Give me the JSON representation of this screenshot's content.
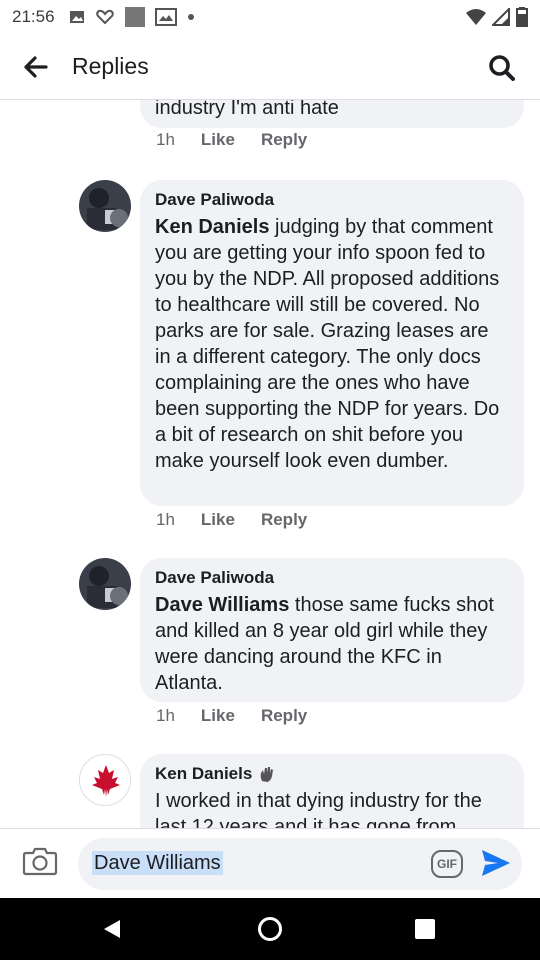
{
  "status_bar": {
    "time": "21:56",
    "icons_left": [
      "image-icon",
      "heart-outline-icon",
      "gray-square-icon",
      "mail-photo-icon",
      "dot-icon"
    ],
    "icons_right": [
      "wifi-icon",
      "signal-icon",
      "battery-icon"
    ]
  },
  "header": {
    "title": "Replies",
    "back_icon": "arrow-left-icon",
    "search_icon": "search-icon"
  },
  "comments": [
    {
      "partial": true,
      "text_tail": "industry I'm anti hate",
      "time": "1h",
      "like_label": "Like",
      "reply_label": "Reply"
    },
    {
      "author": "Dave Paliwoda",
      "mention": "Ken Daniels",
      "text": "judging by that comment you are getting your info spoon fed to you by the NDP. All proposed additions to healthcare will still be covered. No parks are for sale. Grazing leases are in a different category. The only docs complaining are the ones who have been supporting the NDP for years. Do a bit of research on shit before you make yourself look even dumber.",
      "time": "1h",
      "like_label": "Like",
      "reply_label": "Reply"
    },
    {
      "author": "Dave Paliwoda",
      "mention": "Dave Williams",
      "text": "those same fucks shot and killed an 8 year old girl while they were dancing around the KFC in Atlanta.",
      "time": "1h",
      "like_label": "Like",
      "reply_label": "Reply"
    },
    {
      "author": "Ken Daniels",
      "author_badge_icon": "waving-hand-icon",
      "text": "I worked in that dying industry for the last 12 years and it has gone from",
      "partial": true
    }
  ],
  "composer": {
    "camera_icon": "camera-icon",
    "input_value": "Dave Williams",
    "gif_label": "GIF",
    "send_icon": "send-icon"
  },
  "nav_bar": {
    "icons": [
      "nav-back-icon",
      "nav-home-icon",
      "nav-recents-icon"
    ]
  },
  "colors": {
    "bubble_bg": "#f0f2f5",
    "secondary_text": "#65676b",
    "send_blue": "#1877f2",
    "input_highlight": "#c9def7"
  }
}
